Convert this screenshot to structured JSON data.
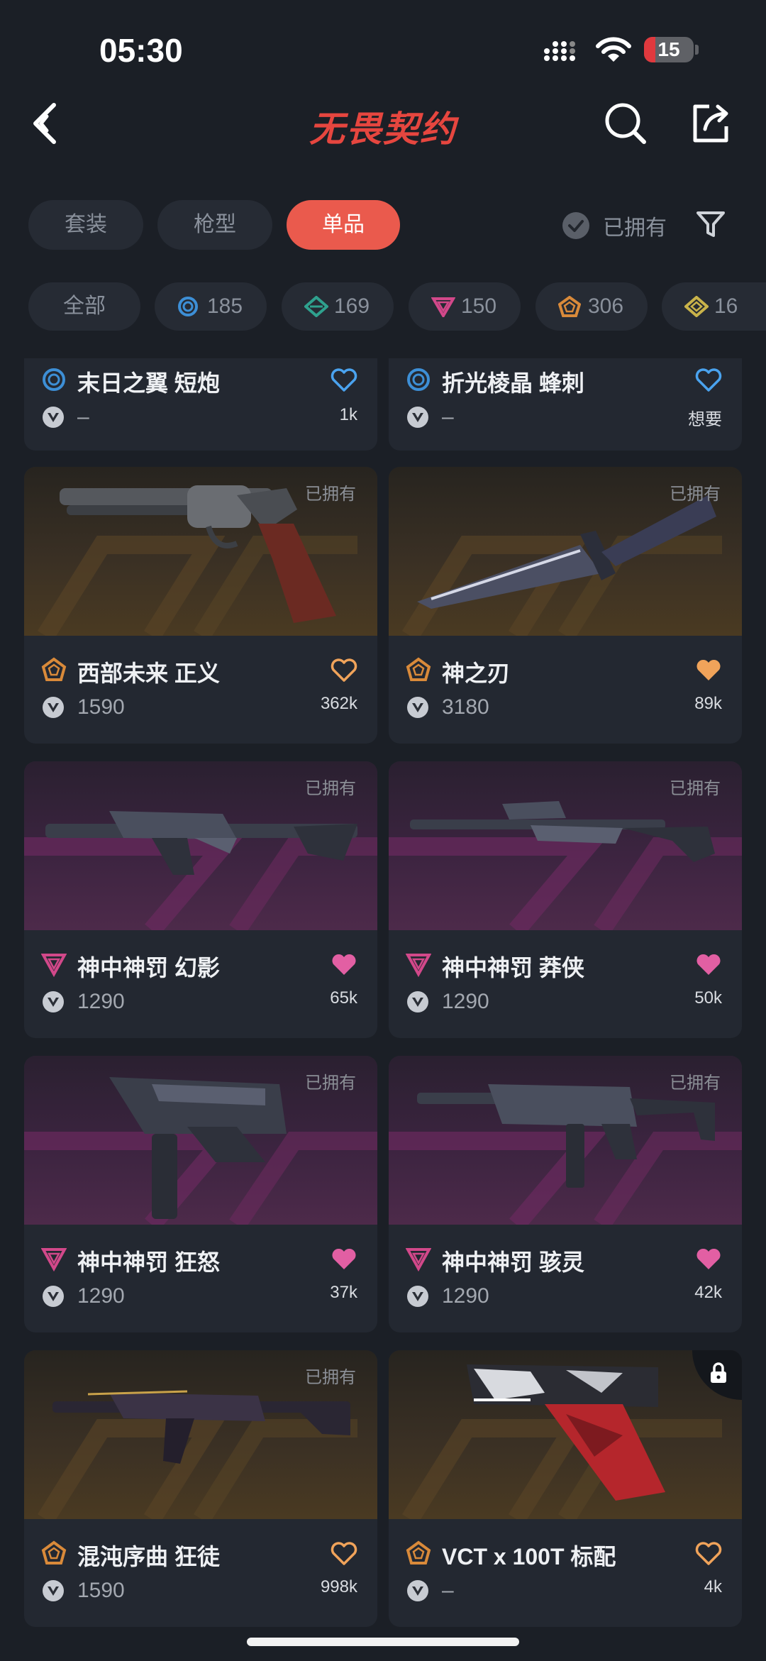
{
  "status_bar": {
    "time": "05:30",
    "battery": "15"
  },
  "header": {
    "logo": "无畏契约"
  },
  "tabs": [
    {
      "label": "套装",
      "active": false
    },
    {
      "label": "枪型",
      "active": false
    },
    {
      "label": "单品",
      "active": true
    }
  ],
  "owned_filter": {
    "label": "已拥有"
  },
  "tier_chips": [
    {
      "label": "全部"
    },
    {
      "label": "185",
      "tier": "select",
      "color": "#3d8fd6"
    },
    {
      "label": "169",
      "tier": "deluxe",
      "color": "#2fa18e"
    },
    {
      "label": "150",
      "tier": "premium",
      "color": "#d2488a"
    },
    {
      "label": "306",
      "tier": "exclusive",
      "color": "#d98a3a"
    },
    {
      "label": "16",
      "tier": "ultra",
      "color": "#c9b34a"
    }
  ],
  "items": [
    {
      "name": "末日之翼 短炮",
      "price": "–",
      "likes": "1k",
      "owned": false,
      "tier": "select",
      "heart": "outline-blue"
    },
    {
      "name": "折光棱晶 蜂刺",
      "price": "–",
      "likes": "想要",
      "owned": false,
      "tier": "select",
      "heart": "outline-blue"
    },
    {
      "name": "西部未来 正义",
      "price": "1590",
      "likes": "362k",
      "owned": true,
      "owned_label": "已拥有",
      "tier": "exclusive",
      "heart": "outline-orange"
    },
    {
      "name": "神之刃",
      "price": "3180",
      "likes": "89k",
      "owned": true,
      "owned_label": "已拥有",
      "tier": "exclusive",
      "heart": "filled-orange"
    },
    {
      "name": "神中神罚 幻影",
      "price": "1290",
      "likes": "65k",
      "owned": true,
      "owned_label": "已拥有",
      "tier": "premium",
      "heart": "filled-pink"
    },
    {
      "name": "神中神罚 莽侠",
      "price": "1290",
      "likes": "50k",
      "owned": true,
      "owned_label": "已拥有",
      "tier": "premium",
      "heart": "filled-pink"
    },
    {
      "name": "神中神罚 狂怒",
      "price": "1290",
      "likes": "37k",
      "owned": true,
      "owned_label": "已拥有",
      "tier": "premium",
      "heart": "filled-pink"
    },
    {
      "name": "神中神罚 骇灵",
      "price": "1290",
      "likes": "42k",
      "owned": true,
      "owned_label": "已拥有",
      "tier": "premium",
      "heart": "filled-pink"
    },
    {
      "name": "混沌序曲 狂徒",
      "price": "1590",
      "likes": "998k",
      "owned": true,
      "owned_label": "已拥有",
      "tier": "exclusive",
      "heart": "outline-orange"
    },
    {
      "name": "VCT x 100T 标配",
      "price": "–",
      "likes": "4k",
      "owned": false,
      "locked": true,
      "tier": "exclusive",
      "heart": "outline-orange"
    }
  ]
}
